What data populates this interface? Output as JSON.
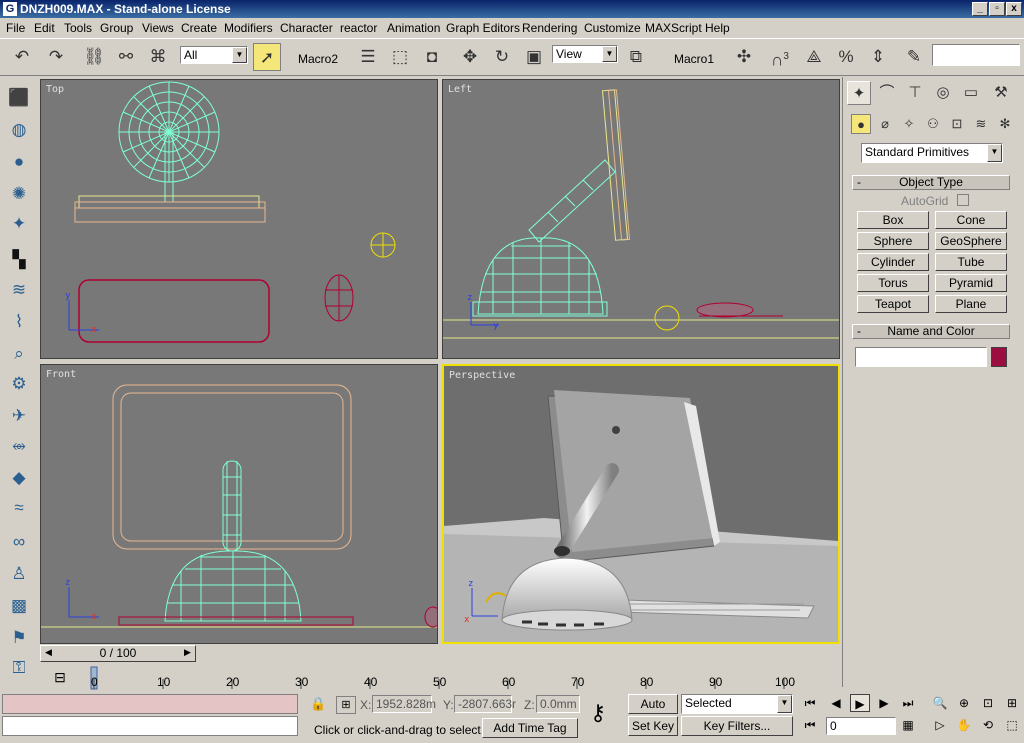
{
  "window": {
    "title": "DNZH009.MAX - Stand-alone License",
    "icon_letter": "G",
    "min": "_",
    "max": "▫",
    "close": "x"
  },
  "menu": [
    "File",
    "Edit",
    "Tools",
    "Group",
    "Views",
    "Create",
    "Modifiers",
    "Character",
    "reactor",
    "Animation",
    "Graph Editors",
    "Rendering",
    "Customize",
    "MAXScript",
    "Help"
  ],
  "toolbar": {
    "selection_filter": "All",
    "macro2": "Macro2",
    "view_dropdown": "View",
    "macro1": "Macro1",
    "snap3": "3",
    "search_value": ""
  },
  "viewports": {
    "top": "Top",
    "left": "Left",
    "front": "Front",
    "perspective": "Perspective"
  },
  "command_panel": {
    "category_dropdown": "Standard Primitives",
    "object_type_header": "Object Type",
    "autogrid": "AutoGrid",
    "primitives": [
      "Box",
      "Cone",
      "Sphere",
      "GeoSphere",
      "Cylinder",
      "Tube",
      "Torus",
      "Pyramid",
      "Teapot",
      "Plane"
    ],
    "name_color_header": "Name and Color",
    "object_name": "",
    "object_color": "#9b0e3f",
    "rollout_minus": "-"
  },
  "timeline": {
    "slider_label": "0 / 100",
    "ticks": [
      "0",
      "10",
      "20",
      "30",
      "40",
      "50",
      "60",
      "70",
      "80",
      "90",
      "100"
    ]
  },
  "status": {
    "x_label": "X:",
    "x_value": "1952.828m",
    "y_label": "Y:",
    "y_value": "-2807.663r",
    "z_label": "Z:",
    "z_value": "0.0mm",
    "prompt": "Click or click-and-drag to select obj",
    "add_time_tag": "Add Time Tag",
    "auto_key": "Auto Key",
    "set_key": "Set Key",
    "key_mode": "Selected",
    "key_filters": "Key Filters...",
    "frame": "0"
  },
  "colors": {
    "accent_yellow": "#f0e000",
    "wire_cyan": "#7fffd4",
    "wire_tan": "#e8b890",
    "wire_red": "#b00030"
  }
}
